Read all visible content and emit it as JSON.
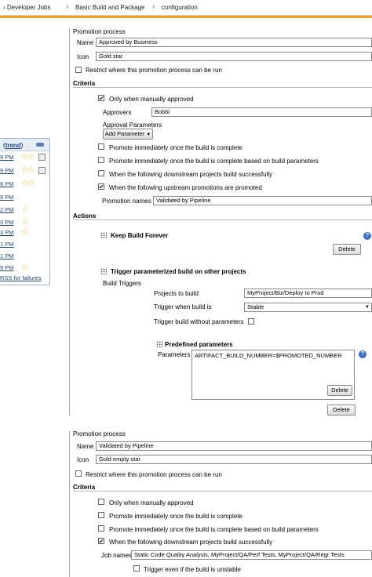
{
  "breadcrumb": {
    "items": [
      "Developer Jobs",
      "Basic Build and Package",
      "configuration"
    ]
  },
  "build_history": {
    "trend_open": "(",
    "trend_label": "trend",
    "trend_close": ")",
    "rows": [
      {
        "time": "9 PM",
        "stars": "☆☆",
        "badge": true
      },
      {
        "time": "9 PM",
        "stars": "☆☆",
        "badge": true
      },
      {
        "time": "6 PM",
        "stars": "☆☆",
        "badge": false
      },
      {
        "time": "9 PM",
        "stars": "",
        "badge": false
      },
      {
        "time": "2 PM",
        "stars": "☆",
        "badge": false
      },
      {
        "time": "3 PM",
        "stars": "☆",
        "badge": false
      },
      {
        "time": "3 PM",
        "stars": "☆",
        "badge": false
      },
      {
        "time": "1 PM",
        "stars": "",
        "badge": false
      },
      {
        "time": "1 PM",
        "stars": "",
        "badge": false
      },
      {
        "time": "9 PM",
        "stars": "☆",
        "badge": false
      }
    ],
    "rss_label": "RSS for failures"
  },
  "promo1": {
    "title": "Promotion process",
    "name_label": "Name",
    "name_value": "Approved by Business",
    "icon_label": "Icon",
    "icon_value": "Gold star",
    "restrict_label": "Restrict where this promotion process can be run",
    "criteria_header": "Criteria",
    "manual_label": "Only when manually approved",
    "approvers_label": "Approvers",
    "approvers_value": "Bobbi",
    "approval_params_label": "Approval Parameters",
    "add_param_label": "Add Parameter",
    "crit_complete": "Promote immediately once the build is complete",
    "crit_complete_params": "Promote immediately once the build is complete based on build parameters",
    "crit_downstream": "When the following downstream projects build successfully",
    "crit_upstream": "When the following upstream promotions are promoted",
    "promotion_names_label": "Promotion names",
    "promotion_names_value": "Validated by Pipeline",
    "actions_header": "Actions",
    "keep_forever_label": "Keep Build Forever",
    "delete_label": "Delete",
    "trigger_label": "Trigger parameterized build on other projects",
    "build_triggers_label": "Build Triggers",
    "projects_label": "Projects to build",
    "projects_value": "MyProject/Biz/Deploy to Prod",
    "trigger_when_label": "Trigger when build is",
    "trigger_when_value": "Stable",
    "trigger_without_label": "Trigger build without parameters",
    "predefined_label": "Predefined parameters",
    "parameters_label": "Parameters",
    "parameters_value": "ARTIFACT_BUILD_NUMBER=$PROMOTED_NUMBER",
    "delete2_label": "Delete",
    "delete3_label": "Delete"
  },
  "promo2": {
    "title": "Promotion process",
    "name_label": "Name",
    "name_value": "Validated by Pipeline",
    "icon_label": "Icon",
    "icon_value": "Gold empty star",
    "restrict_label": "Restrict where this promotion process can be run",
    "criteria_header": "Criteria",
    "manual_label": "Only when manually approved",
    "crit_complete": "Promote immediately once the build is complete",
    "crit_complete_params": "Promote immediately once the build is complete based on build parameters",
    "crit_downstream": "When the following downstream projects build successfully",
    "job_names_label": "Job names",
    "job_names_value": "Static Code Quality Analysis, MyProject/QA/Perf Tests, MyProject/QA/Regr Tests",
    "unstable_label": "Trigger even if the build is unstable"
  },
  "icons": {
    "help": "?",
    "check": "✔",
    "dropdown": "▼",
    "breadcrumb_sep": "›"
  }
}
